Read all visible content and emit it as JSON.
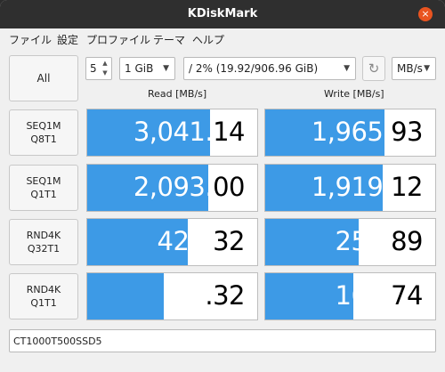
{
  "window": {
    "title": "KDiskMark",
    "close_glyph": "×"
  },
  "menu": [
    "ファイル",
    "設定",
    "プロファイル",
    "テーマ",
    "ヘルプ"
  ],
  "controls": {
    "all_label": "All",
    "runs": "5",
    "size": "1 GiB",
    "drive": "/ 2% (19.92/906.96 GiB)",
    "unit": "MB/s",
    "refresh_icon": "refresh-icon"
  },
  "headers": {
    "read": "Read [MB/s]",
    "write": "Write [MB/s]"
  },
  "rows": [
    {
      "line1": "SEQ1M",
      "line2": "Q8T1",
      "read": "3,041.14",
      "read_fill": 0.72,
      "read_split": 6,
      "write": "1,965.93",
      "write_fill": 0.7,
      "write_split": 6
    },
    {
      "line1": "SEQ1M",
      "line2": "Q1T1",
      "read": "2,093.00",
      "read_fill": 0.71,
      "read_split": 6,
      "write": "1,919.12",
      "write_fill": 0.69,
      "write_split": 6
    },
    {
      "line1": "RND4K",
      "line2": "Q32T1",
      "read": "421.32",
      "read_fill": 0.59,
      "read_split": 4,
      "write": "255.89",
      "write_fill": 0.55,
      "write_split": 4
    },
    {
      "line1": "RND4K",
      "line2": "Q1T1",
      "read": "65.32",
      "read_fill": 0.45,
      "read_split": 2,
      "write": "160.74",
      "write_fill": 0.52,
      "write_split": 4
    }
  ],
  "comment": "CT1000T500SSD5",
  "colors": {
    "bar": "#3d9ae6",
    "titlebar": "#2f2f2f",
    "close": "#e95420"
  }
}
